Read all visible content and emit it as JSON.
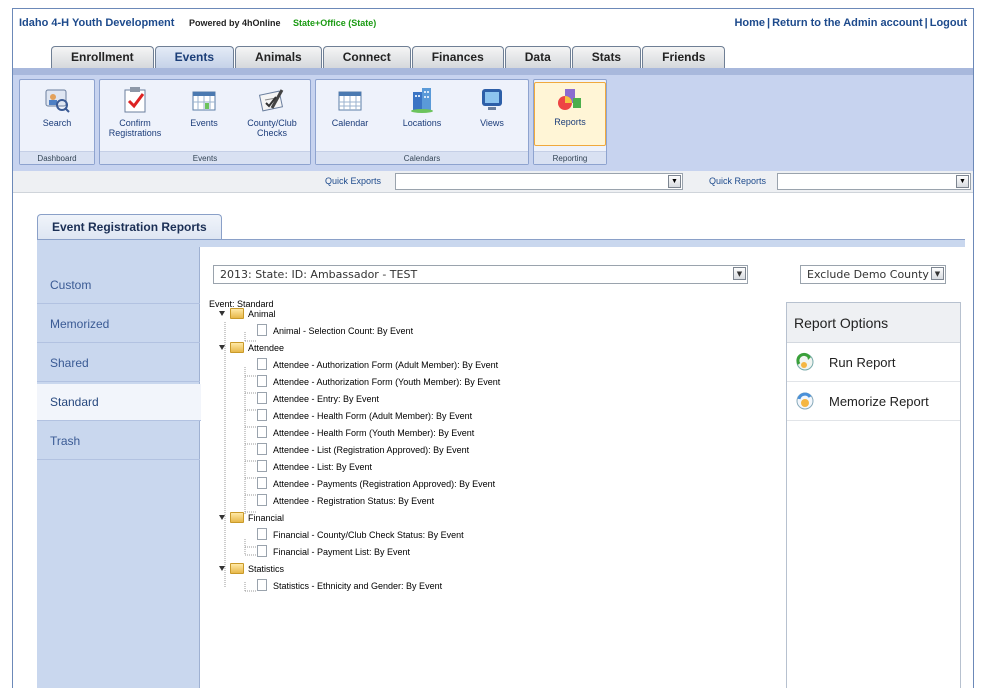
{
  "header": {
    "brand": "Idaho 4-H Youth Development",
    "powered": "Powered by 4hOnline",
    "role": "State+Office (State)",
    "links": [
      "Home",
      "Return to the Admin account",
      "Logout"
    ]
  },
  "tabs": [
    "Enrollment",
    "Events",
    "Animals",
    "Connect",
    "Finances",
    "Data",
    "Stats",
    "Friends"
  ],
  "active_tab": "Events",
  "ribbon": {
    "groups": [
      {
        "label": "Dashboard",
        "buttons": [
          {
            "label": "Search",
            "icon": "search-people-icon"
          }
        ]
      },
      {
        "label": "Events",
        "buttons": [
          {
            "label": "Confirm Registrations",
            "icon": "checkbox-icon"
          },
          {
            "label": "Events",
            "icon": "calendar-grid-icon"
          },
          {
            "label": "County/Club Checks",
            "icon": "checks-icon"
          }
        ]
      },
      {
        "label": "Calendars",
        "buttons": [
          {
            "label": "Calendar",
            "icon": "calendar-icon"
          },
          {
            "label": "Locations",
            "icon": "buildings-icon"
          },
          {
            "label": "Views",
            "icon": "monitor-icon"
          }
        ]
      },
      {
        "label": "Reporting",
        "buttons": [
          {
            "label": "Reports",
            "icon": "reports-chart-icon"
          }
        ]
      }
    ]
  },
  "quick": {
    "exports_label": "Quick Exports",
    "reports_label": "Quick Reports"
  },
  "panel": {
    "title": "Event Registration Reports",
    "sidebar": [
      "Custom",
      "Memorized",
      "Shared",
      "Standard",
      "Trash"
    ],
    "active_sidebar": "Standard",
    "event_select": "2013: State: ID: Ambassador - TEST",
    "demo_select": "Exclude Demo County",
    "tree_root": "Event: Standard",
    "tree": [
      {
        "folder": "Animal",
        "items": [
          "Animal - Selection Count: By Event"
        ]
      },
      {
        "folder": "Attendee",
        "items": [
          "Attendee - Authorization Form (Adult Member): By Event",
          "Attendee - Authorization Form (Youth Member): By Event",
          "Attendee - Entry: By Event",
          "Attendee - Health Form (Adult Member): By Event",
          "Attendee - Health Form (Youth Member): By Event",
          "Attendee - List (Registration Approved): By Event",
          "Attendee - List: By Event",
          "Attendee - Payments (Registration Approved): By Event",
          "Attendee - Registration Status: By Event"
        ]
      },
      {
        "folder": "Financial",
        "items": [
          "Financial - County/Club Check Status: By Event",
          "Financial - Payment List: By Event"
        ]
      },
      {
        "folder": "Statistics",
        "items": [
          "Statistics - Ethnicity and Gender: By Event"
        ]
      }
    ],
    "options": {
      "title": "Report Options",
      "items": [
        {
          "label": "Run Report",
          "icon": "run-report-icon"
        },
        {
          "label": "Memorize Report",
          "icon": "memorize-report-icon"
        }
      ]
    }
  },
  "colors": {
    "accent": "#1d4a8c",
    "role_green": "#1a9a12",
    "ribbon_bg": "#c7d3ef"
  }
}
